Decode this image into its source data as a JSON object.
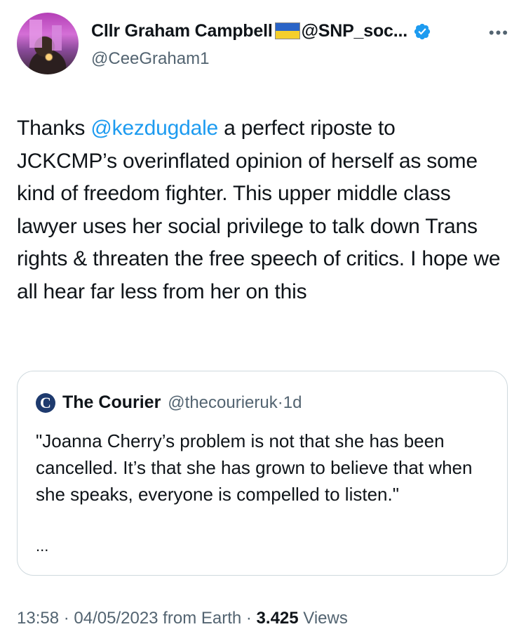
{
  "author": {
    "display_name": "Cllr Graham Campbell",
    "handle_suffix": "@SNP_soc...",
    "username": "@CeeGraham1",
    "flag_colors": [
      "#2a64c7",
      "#f4cf2c"
    ],
    "verified_color": "#1d9bf0"
  },
  "tweet": {
    "prefix": "Thanks ",
    "mention": "@kezdugdale",
    "body": " a perfect riposte to JCKCMP’s overinflated opinion of herself as some kind of freedom fighter. This upper middle class lawyer uses her social privilege to talk down Trans rights & threaten the free speech of critics. I hope we all hear far less from her on this"
  },
  "quote": {
    "logo_letter": "C",
    "name": "The Courier",
    "handle": "@thecourieruk",
    "separator": "·",
    "age": "1d",
    "text": "\"Joanna Cherry’s problem is not that she has been cancelled. It’s that she has grown to believe that when she speaks, everyone is compelled to listen.\"",
    "ellipsis": "..."
  },
  "footer": {
    "time": "13:58",
    "sep1": " · ",
    "date": "04/05/2023",
    "source": " from Earth",
    "sep2": " · ",
    "views_count": "3.425",
    "views_label": " Views"
  },
  "more_icon": "more-horizontal-icon",
  "colors": {
    "link": "#1d9bf0",
    "secondary": "#536471",
    "border": "#cfd9de"
  }
}
